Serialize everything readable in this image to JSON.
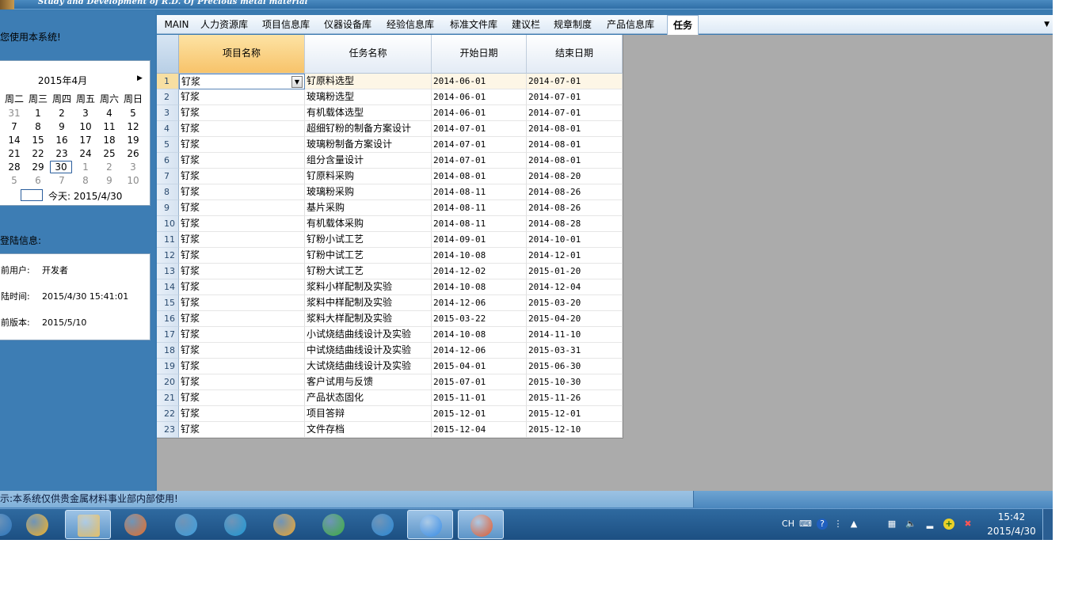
{
  "app": {
    "title": "Study and Development of R.D. Of Precious metal material"
  },
  "left": {
    "welcome": "您使用本系统!",
    "calendar": {
      "month_label": "2015年4月",
      "weekdays": [
        "-",
        "周二",
        "周三",
        "周四",
        "周五",
        "周六",
        "周日"
      ],
      "weeks": [
        [
          "",
          "31",
          "1",
          "2",
          "3",
          "4",
          "5"
        ],
        [
          "",
          "7",
          "8",
          "9",
          "10",
          "11",
          "12"
        ],
        [
          "",
          "14",
          "15",
          "16",
          "17",
          "18",
          "19"
        ],
        [
          "",
          "21",
          "22",
          "23",
          "24",
          "25",
          "26"
        ],
        [
          "",
          "28",
          "29",
          "30",
          "1",
          "2",
          "3"
        ],
        [
          "",
          "5",
          "6",
          "7",
          "8",
          "9",
          "10"
        ]
      ],
      "today_label": "今天: 2015/4/30"
    },
    "login_title": "登陆信息:",
    "login": [
      {
        "key": "前用户:",
        "value": "开发者"
      },
      {
        "key": "陆时间:",
        "value": "2015/4/30 15:41:01"
      },
      {
        "key": "前版本:",
        "value": "2015/5/10"
      }
    ]
  },
  "tabs": [
    "MAIN",
    "人力资源库",
    "项目信息库",
    "仪器设备库",
    "经验信息库",
    "标准文件库",
    "建议栏",
    "规章制度",
    "产品信息库",
    "任务"
  ],
  "active_tab": "任务",
  "grid": {
    "columns": [
      "项目名称",
      "任务名称",
      "开始日期",
      "结束日期"
    ],
    "rows": [
      [
        "1",
        "钌浆",
        "钌原料选型",
        "2014-06-01",
        "2014-07-01"
      ],
      [
        "2",
        "钌浆",
        "玻璃粉选型",
        "2014-06-01",
        "2014-07-01"
      ],
      [
        "3",
        "钌浆",
        "有机载体选型",
        "2014-06-01",
        "2014-07-01"
      ],
      [
        "4",
        "钌浆",
        "超细钌粉的制备方案设计",
        "2014-07-01",
        "2014-08-01"
      ],
      [
        "5",
        "钌浆",
        "玻璃粉制备方案设计",
        "2014-07-01",
        "2014-08-01"
      ],
      [
        "6",
        "钌浆",
        "组分含量设计",
        "2014-07-01",
        "2014-08-01"
      ],
      [
        "7",
        "钌浆",
        "钌原料采购",
        "2014-08-01",
        "2014-08-20"
      ],
      [
        "8",
        "钌浆",
        "玻璃粉采购",
        "2014-08-11",
        "2014-08-26"
      ],
      [
        "9",
        "钌浆",
        "基片采购",
        "2014-08-11",
        "2014-08-26"
      ],
      [
        "10",
        "钌浆",
        "有机载体采购",
        "2014-08-11",
        "2014-08-28"
      ],
      [
        "11",
        "钌浆",
        "钌粉小试工艺",
        "2014-09-01",
        "2014-10-01"
      ],
      [
        "12",
        "钌浆",
        "钌粉中试工艺",
        "2014-10-08",
        "2014-12-01"
      ],
      [
        "13",
        "钌浆",
        "钌粉大试工艺",
        "2014-12-02",
        "2015-01-20"
      ],
      [
        "14",
        "钌浆",
        "浆料小样配制及实验",
        "2014-10-08",
        "2014-12-04"
      ],
      [
        "15",
        "钌浆",
        "浆料中样配制及实验",
        "2014-12-06",
        "2015-03-20"
      ],
      [
        "16",
        "钌浆",
        "浆料大样配制及实验",
        "2015-03-22",
        "2015-04-20"
      ],
      [
        "17",
        "钌浆",
        "小试烧结曲线设计及实验",
        "2014-10-08",
        "2014-11-10"
      ],
      [
        "18",
        "钌浆",
        "中试烧结曲线设计及实验",
        "2014-12-06",
        "2015-03-31"
      ],
      [
        "19",
        "钌浆",
        "大试烧结曲线设计及实验",
        "2015-04-01",
        "2015-06-30"
      ],
      [
        "20",
        "钌浆",
        "客户试用与反馈",
        "2015-07-01",
        "2015-10-30"
      ],
      [
        "21",
        "钌浆",
        "产品状态固化",
        "2015-11-01",
        "2015-11-26"
      ],
      [
        "22",
        "钌浆",
        "项目答辩",
        "2015-12-01",
        "2015-12-01"
      ],
      [
        "23",
        "钌浆",
        "文件存档",
        "2015-12-04",
        "2015-12-10"
      ]
    ]
  },
  "status": {
    "text": "示:本系统仅供贵金属材料事业部内部使用!"
  },
  "taskbar": {
    "apps": [
      "start-orb-icon",
      "color-apps-icon",
      "file-explorer-icon",
      "media-player-icon",
      "bird-app-icon",
      "cloud-app-icon",
      "box-app-icon",
      "refresh-app-icon",
      "k-app-icon",
      "internet-explorer-icon",
      "fox-app-icon"
    ],
    "tray": {
      "lang": "CH",
      "time": "15:42",
      "date": "2015/4/30"
    }
  },
  "colors": {
    "panel_blue": "#3d7db4",
    "header_highlight": "#f7c36a",
    "taskbar": "#1c4f82"
  }
}
